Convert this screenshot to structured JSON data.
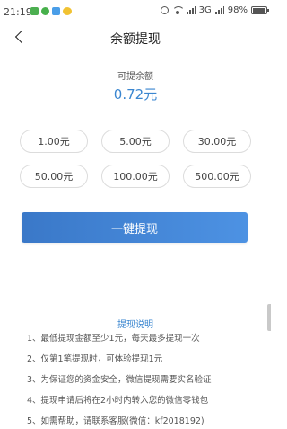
{
  "status_bar": {
    "time": "21:19",
    "network": "3G",
    "battery": "98%",
    "battery_level": 0.98
  },
  "header": {
    "title": "余额提现"
  },
  "balance": {
    "label": "可提余额",
    "value": "0.72元"
  },
  "amounts": [
    "1.00元",
    "5.00元",
    "30.00元",
    "50.00元",
    "100.00元",
    "500.00元"
  ],
  "withdraw_button": "一键提现",
  "instructions": {
    "title": "提现说明",
    "items": [
      "1、最低提现金额至少1元，每天最多提现一次",
      "2、仅第1笔提现时，可体验提现1元",
      "3、为保证您的资金安全，微信提现需要实名验证",
      "4、提现申请后将在2小时内转入您的微信零钱包",
      "5、如需帮助，请联系客服(微信：kf2018192)"
    ]
  },
  "colors": {
    "accent": "#3a86d0",
    "button_start": "#3a78c8",
    "button_end": "#4d92e3"
  }
}
